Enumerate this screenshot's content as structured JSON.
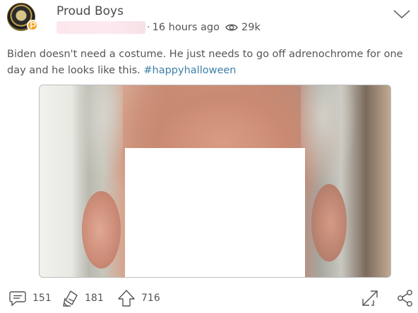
{
  "post": {
    "author": "Proud Boys",
    "separator": "·",
    "time_ago": "16 hours ago",
    "views": "29k",
    "text": "Biden doesn't need a costume. He just needs to go off adrenochrome for one day and he looks like this. ",
    "hashtag": "#happyhalloween"
  },
  "actions": {
    "comments": "151",
    "reposts": "181",
    "upvotes": "716"
  },
  "icons": {
    "avatar": "avatar",
    "badge": "verified-badge-icon",
    "eye": "eye-icon",
    "chevron": "chevron-down-icon",
    "comment": "comment-icon",
    "repost": "repost-icon",
    "upvote": "upvote-icon",
    "expand": "expand-icon",
    "share": "share-icon"
  },
  "colors": {
    "hashtag": "#3d7fa8",
    "badge": "#f2a31a",
    "text": "#555555"
  }
}
